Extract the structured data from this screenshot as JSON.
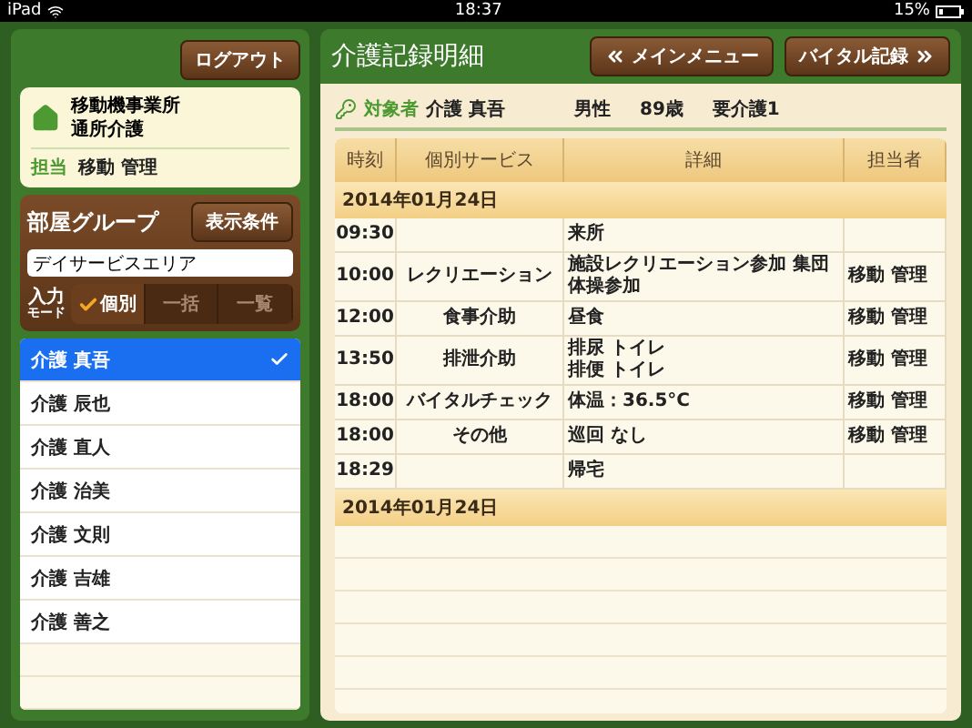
{
  "status_bar": {
    "device": "iPad",
    "time": "18:37",
    "battery": "15%"
  },
  "sidebar": {
    "logout_button": "ログアウト",
    "facility": {
      "lines": [
        "移動機事業所",
        "通所介護"
      ],
      "staff_label": "担当",
      "staff": "移動 管理"
    },
    "group_title": "部屋グループ",
    "filter_button": "表示条件",
    "group_field": {
      "value": "デイサービスエリア"
    },
    "mode_label": [
      "入力",
      "モード"
    ],
    "modes": [
      {
        "label": "個別",
        "selected": true
      },
      {
        "label": "一括",
        "selected": false
      },
      {
        "label": "一覧",
        "selected": false
      }
    ],
    "residents": [
      {
        "name": "介護 真吾",
        "selected": true
      },
      {
        "name": "介護 辰也",
        "selected": false
      },
      {
        "name": "介護 直人",
        "selected": false
      },
      {
        "name": "介護 治美",
        "selected": false
      },
      {
        "name": "介護 文則",
        "selected": false
      },
      {
        "name": "介護 吉雄",
        "selected": false
      },
      {
        "name": "介護 善之",
        "selected": false
      }
    ]
  },
  "main": {
    "title": "介護記録明細",
    "menu_button": "メインメニュー",
    "vital_button": "バイタル記録",
    "subject": {
      "label": "対象者",
      "name": "介護 真吾",
      "gender": "男性",
      "age": "89歳",
      "care_level": "要介護1"
    },
    "table": {
      "columns": [
        "時刻",
        "個別サービス",
        "詳細",
        "担当者"
      ],
      "groups": [
        {
          "date": "2014年01月24日",
          "rows": [
            {
              "time": "09:30",
              "service": "",
              "detail": [
                "来所"
              ],
              "staff": ""
            },
            {
              "time": "10:00",
              "service": "レクリエーション",
              "detail": [
                "施設レクリエーション参加 集団体操参加"
              ],
              "staff": "移動 管理"
            },
            {
              "time": "12:00",
              "service": "食事介助",
              "detail": [
                "昼食"
              ],
              "staff": "移動 管理"
            },
            {
              "time": "13:50",
              "service": "排泄介助",
              "detail": [
                "排尿 トイレ",
                "排便 トイレ"
              ],
              "staff": "移動 管理"
            },
            {
              "time": "18:00",
              "service": "バイタルチェック",
              "detail": [
                "体温：36.5°C"
              ],
              "staff": "移動 管理"
            },
            {
              "time": "18:00",
              "service": "その他",
              "detail": [
                "巡回 なし"
              ],
              "staff": "移動 管理"
            },
            {
              "time": "18:29",
              "service": "",
              "detail": [
                "帰宅"
              ],
              "staff": ""
            }
          ]
        },
        {
          "date": "2014年01月24日"
        }
      ]
    }
  }
}
